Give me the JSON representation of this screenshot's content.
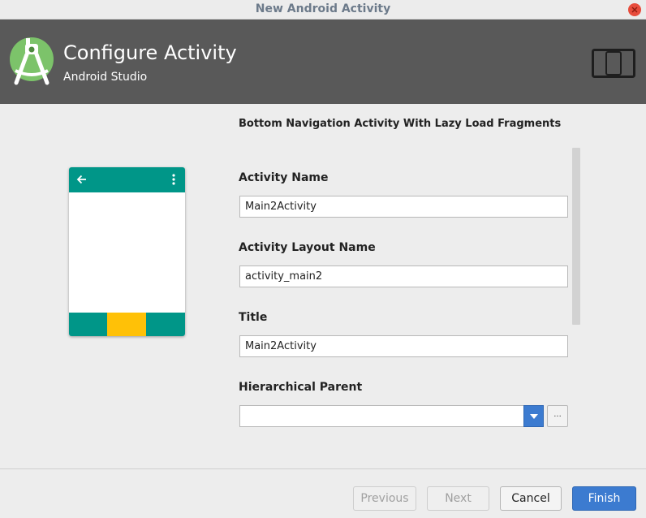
{
  "window": {
    "title": "New Android Activity"
  },
  "header": {
    "title": "Configure Activity",
    "subtitle": "Android Studio"
  },
  "activity_type": "Bottom Navigation Activity With Lazy Load Fragments",
  "form": {
    "activity_name": {
      "label": "Activity Name",
      "value": "Main2Activity"
    },
    "layout_name": {
      "label": "Activity Layout Name",
      "value": "activity_main2"
    },
    "title": {
      "label": "Title",
      "value": "Main2Activity"
    },
    "hierarchical_parent": {
      "label": "Hierarchical Parent",
      "value": "",
      "browse_label": "..."
    }
  },
  "preview": {
    "appbar_color": "#009688",
    "selected_tab_color": "#ffc107"
  },
  "footer": {
    "previous_label": "Previous",
    "next_label": "Next",
    "cancel_label": "Cancel",
    "finish_label": "Finish"
  }
}
